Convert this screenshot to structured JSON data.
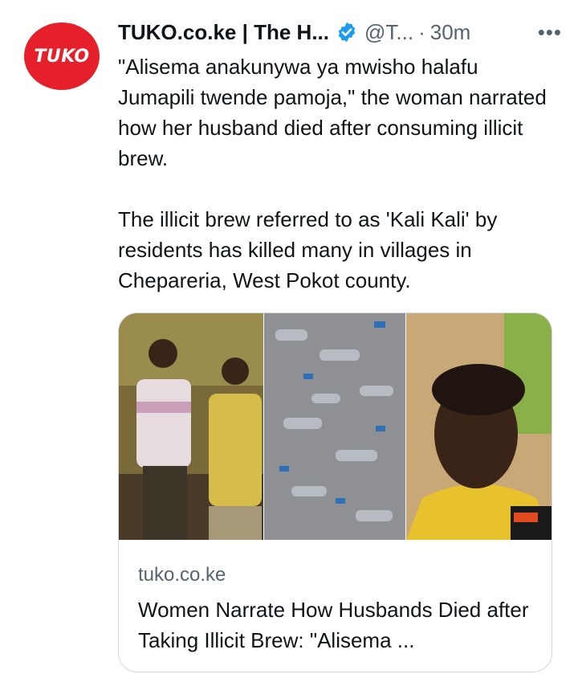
{
  "account": {
    "avatar_text": "TUKO",
    "name": "TUKO.co.ke | The H...",
    "handle": "@T...",
    "separator": "·",
    "time": "30m",
    "more_label": "•••"
  },
  "tweet": {
    "paragraph1": "\"Alisema anakunywa ya mwisho halafu Jumapili twende pamoja,\" the woman narrated how her husband died after consuming illicit brew.",
    "paragraph2": "The illicit brew referred to as 'Kali Kali' by residents has killed many in villages in Chepareria, West Pokot county."
  },
  "card": {
    "domain": "tuko.co.ke",
    "title": "Women Narrate How Husbands Died after Taking Illicit Brew: \"Alisema ..."
  },
  "colors": {
    "brand_red": "#e5202a",
    "verified_blue": "#1d9bf0",
    "secondary_text": "#536471",
    "border": "#cfd9de"
  },
  "icons": {
    "verified": "verified-badge-icon",
    "more": "more-horizontal-icon"
  }
}
